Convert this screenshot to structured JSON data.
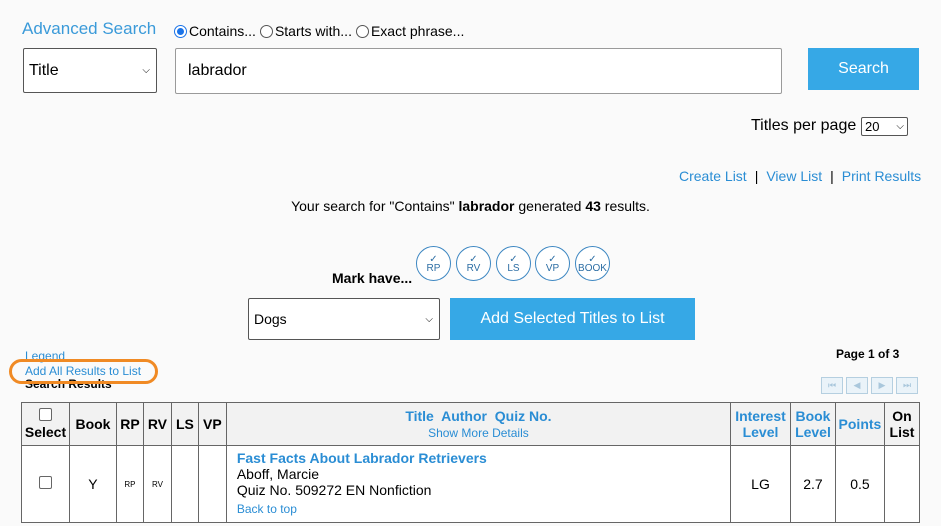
{
  "header": {
    "title": "Advanced Search",
    "radio_options": [
      {
        "label": "Contains...",
        "checked": true
      },
      {
        "label": "Starts with...",
        "checked": false
      },
      {
        "label": "Exact phrase...",
        "checked": false
      }
    ]
  },
  "search": {
    "field": "Title",
    "query": "labrador",
    "button": "Search"
  },
  "paging": {
    "titles_per_page_label": "Titles per page",
    "titles_per_page": "20",
    "page_info": "Page 1 of 3"
  },
  "links": {
    "create_list": "Create List",
    "view_list": "View List",
    "print_results": "Print Results",
    "separator": "|"
  },
  "summary": {
    "prefix": "Your search for \"Contains\"",
    "term": "labrador",
    "middle": "generated",
    "count": "43",
    "suffix": "results."
  },
  "mark": {
    "label": "Mark have...",
    "check": "✓",
    "options": [
      "RP",
      "RV",
      "LS",
      "VP",
      "BOOK"
    ]
  },
  "list": {
    "selected": "Dogs",
    "add_selected_button": "Add Selected Titles to List"
  },
  "side": {
    "legend": "Legend",
    "add_all": "Add All Results to List",
    "search_results": "Search Results"
  },
  "table": {
    "headers": {
      "select": "Select",
      "book": "Book",
      "rp": "RP",
      "rv": "RV",
      "ls": "LS",
      "vp": "VP",
      "title": "Title  Author  Quiz No.",
      "show_more": "Show More Details",
      "interest_level": "Interest Level",
      "book_level": "Book Level",
      "points": "Points",
      "on_list": "On List"
    },
    "rows": [
      {
        "book": "Y",
        "rp": "RP",
        "rv": "RV",
        "ls": "",
        "vp": "",
        "title": "Fast Facts About Labrador Retrievers",
        "author": "Aboff, Marcie",
        "quiz": "Quiz No. 509272 EN Nonfiction",
        "back_to_top": "Back to top",
        "interest_level": "LG",
        "book_level": "2.7",
        "points": "0.5",
        "on_list": ""
      }
    ]
  },
  "colors": {
    "accent": "#36a8e6",
    "link": "#2a8dd4",
    "highlight": "#f08a24"
  }
}
